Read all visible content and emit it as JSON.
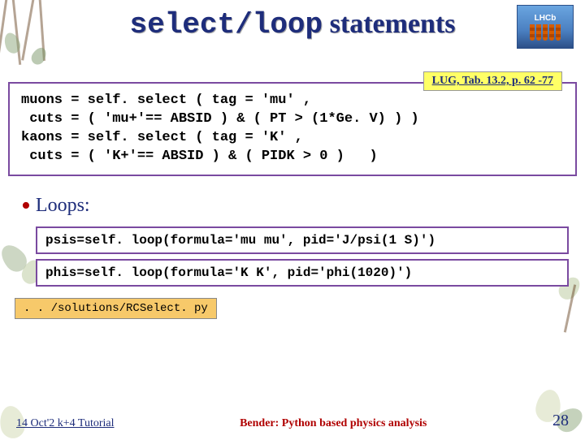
{
  "title_mono": "select/loop",
  "title_rest": " statements",
  "logo_line1": "LHCb",
  "badge": "LUG, Tab. 13.2, p. 62 -77",
  "code_main": "muons = self. select ( tag = 'mu' ,\n cuts = ( 'mu+'== ABSID ) & ( PT > (1*Ge. V) ) )\nkaons = self. select ( tag = 'K' ,\n cuts = ( 'K+'== ABSID ) & ( PIDK > 0 )   )",
  "loops_label": "Loops:",
  "loop1": "psis=self. loop(formula='mu mu', pid='J/psi(1 S)')",
  "loop2": "phis=self. loop(formula='K K', pid='phi(1020)')",
  "path": ". . /solutions/RCSelect. py",
  "footer_left": "14 Oct'2 k+4 Tutorial",
  "footer_mid": "Bender: Python based physics analysis",
  "page_num": "28"
}
